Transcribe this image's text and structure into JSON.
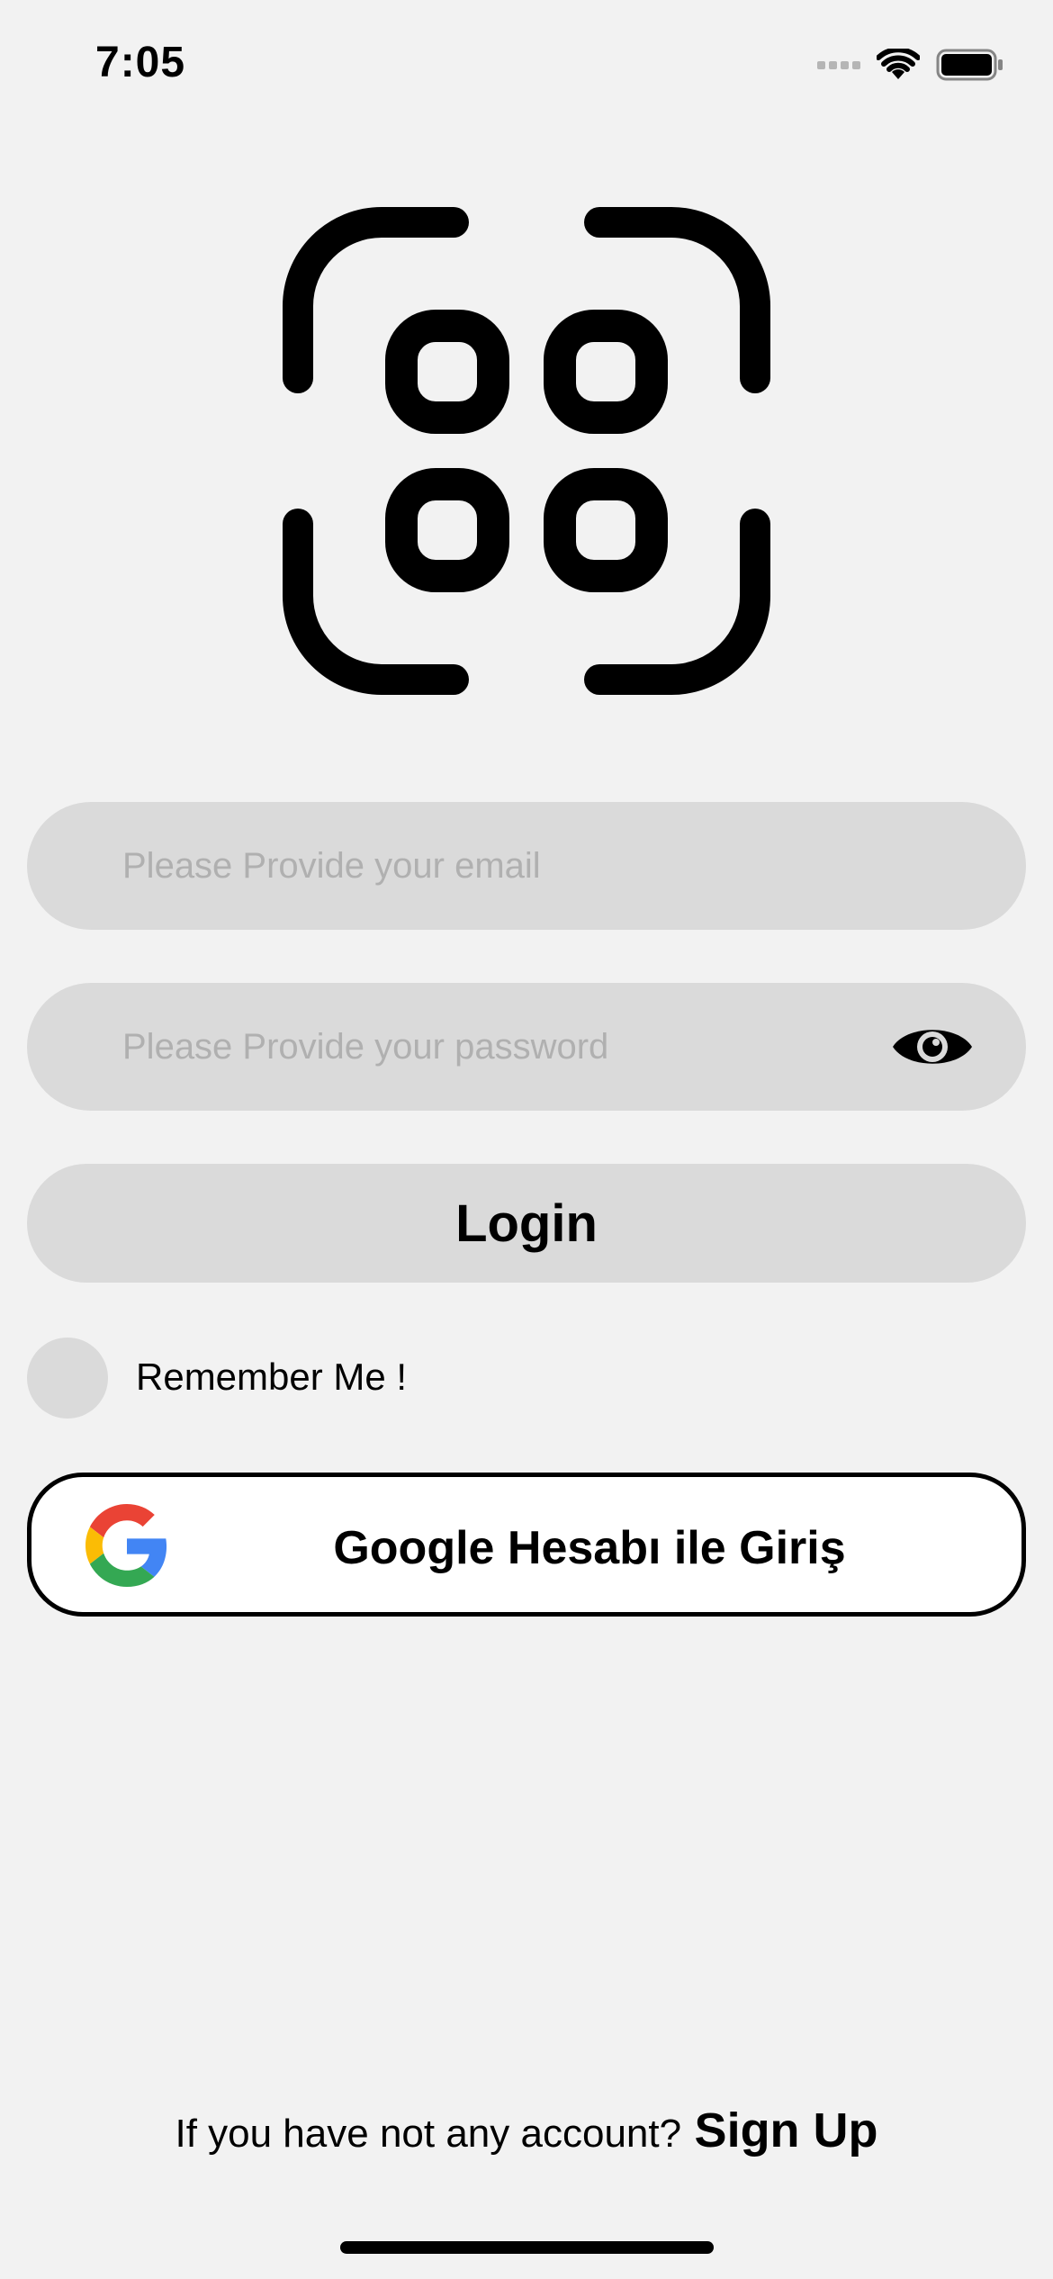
{
  "status_bar": {
    "time": "7:05",
    "icons": [
      "cellular-signal-icon",
      "wifi-icon",
      "battery-icon"
    ]
  },
  "logo": {
    "icon": "scan-grid-icon"
  },
  "login_form": {
    "email_placeholder": "Please Provide your email",
    "email_value": "",
    "password_placeholder": "Please Provide your password",
    "password_value": "",
    "show_password_icon": "eye-icon",
    "login_label": "Login",
    "remember_label": "Remember Me !",
    "remember_checked": false
  },
  "google_sign_in": {
    "icon": "google-icon",
    "label": "Google Hesabı ile Giriş"
  },
  "footer": {
    "prompt": "If you have not any account?",
    "signup_label": "Sign Up"
  },
  "colors": {
    "background": "#f2f2f2",
    "field_background": "#dadada",
    "placeholder": "#b0b0b0",
    "text": "#000000",
    "google_red": "#ea4335",
    "google_yellow": "#fbbc05",
    "google_green": "#34a853",
    "google_blue": "#4285f4"
  }
}
